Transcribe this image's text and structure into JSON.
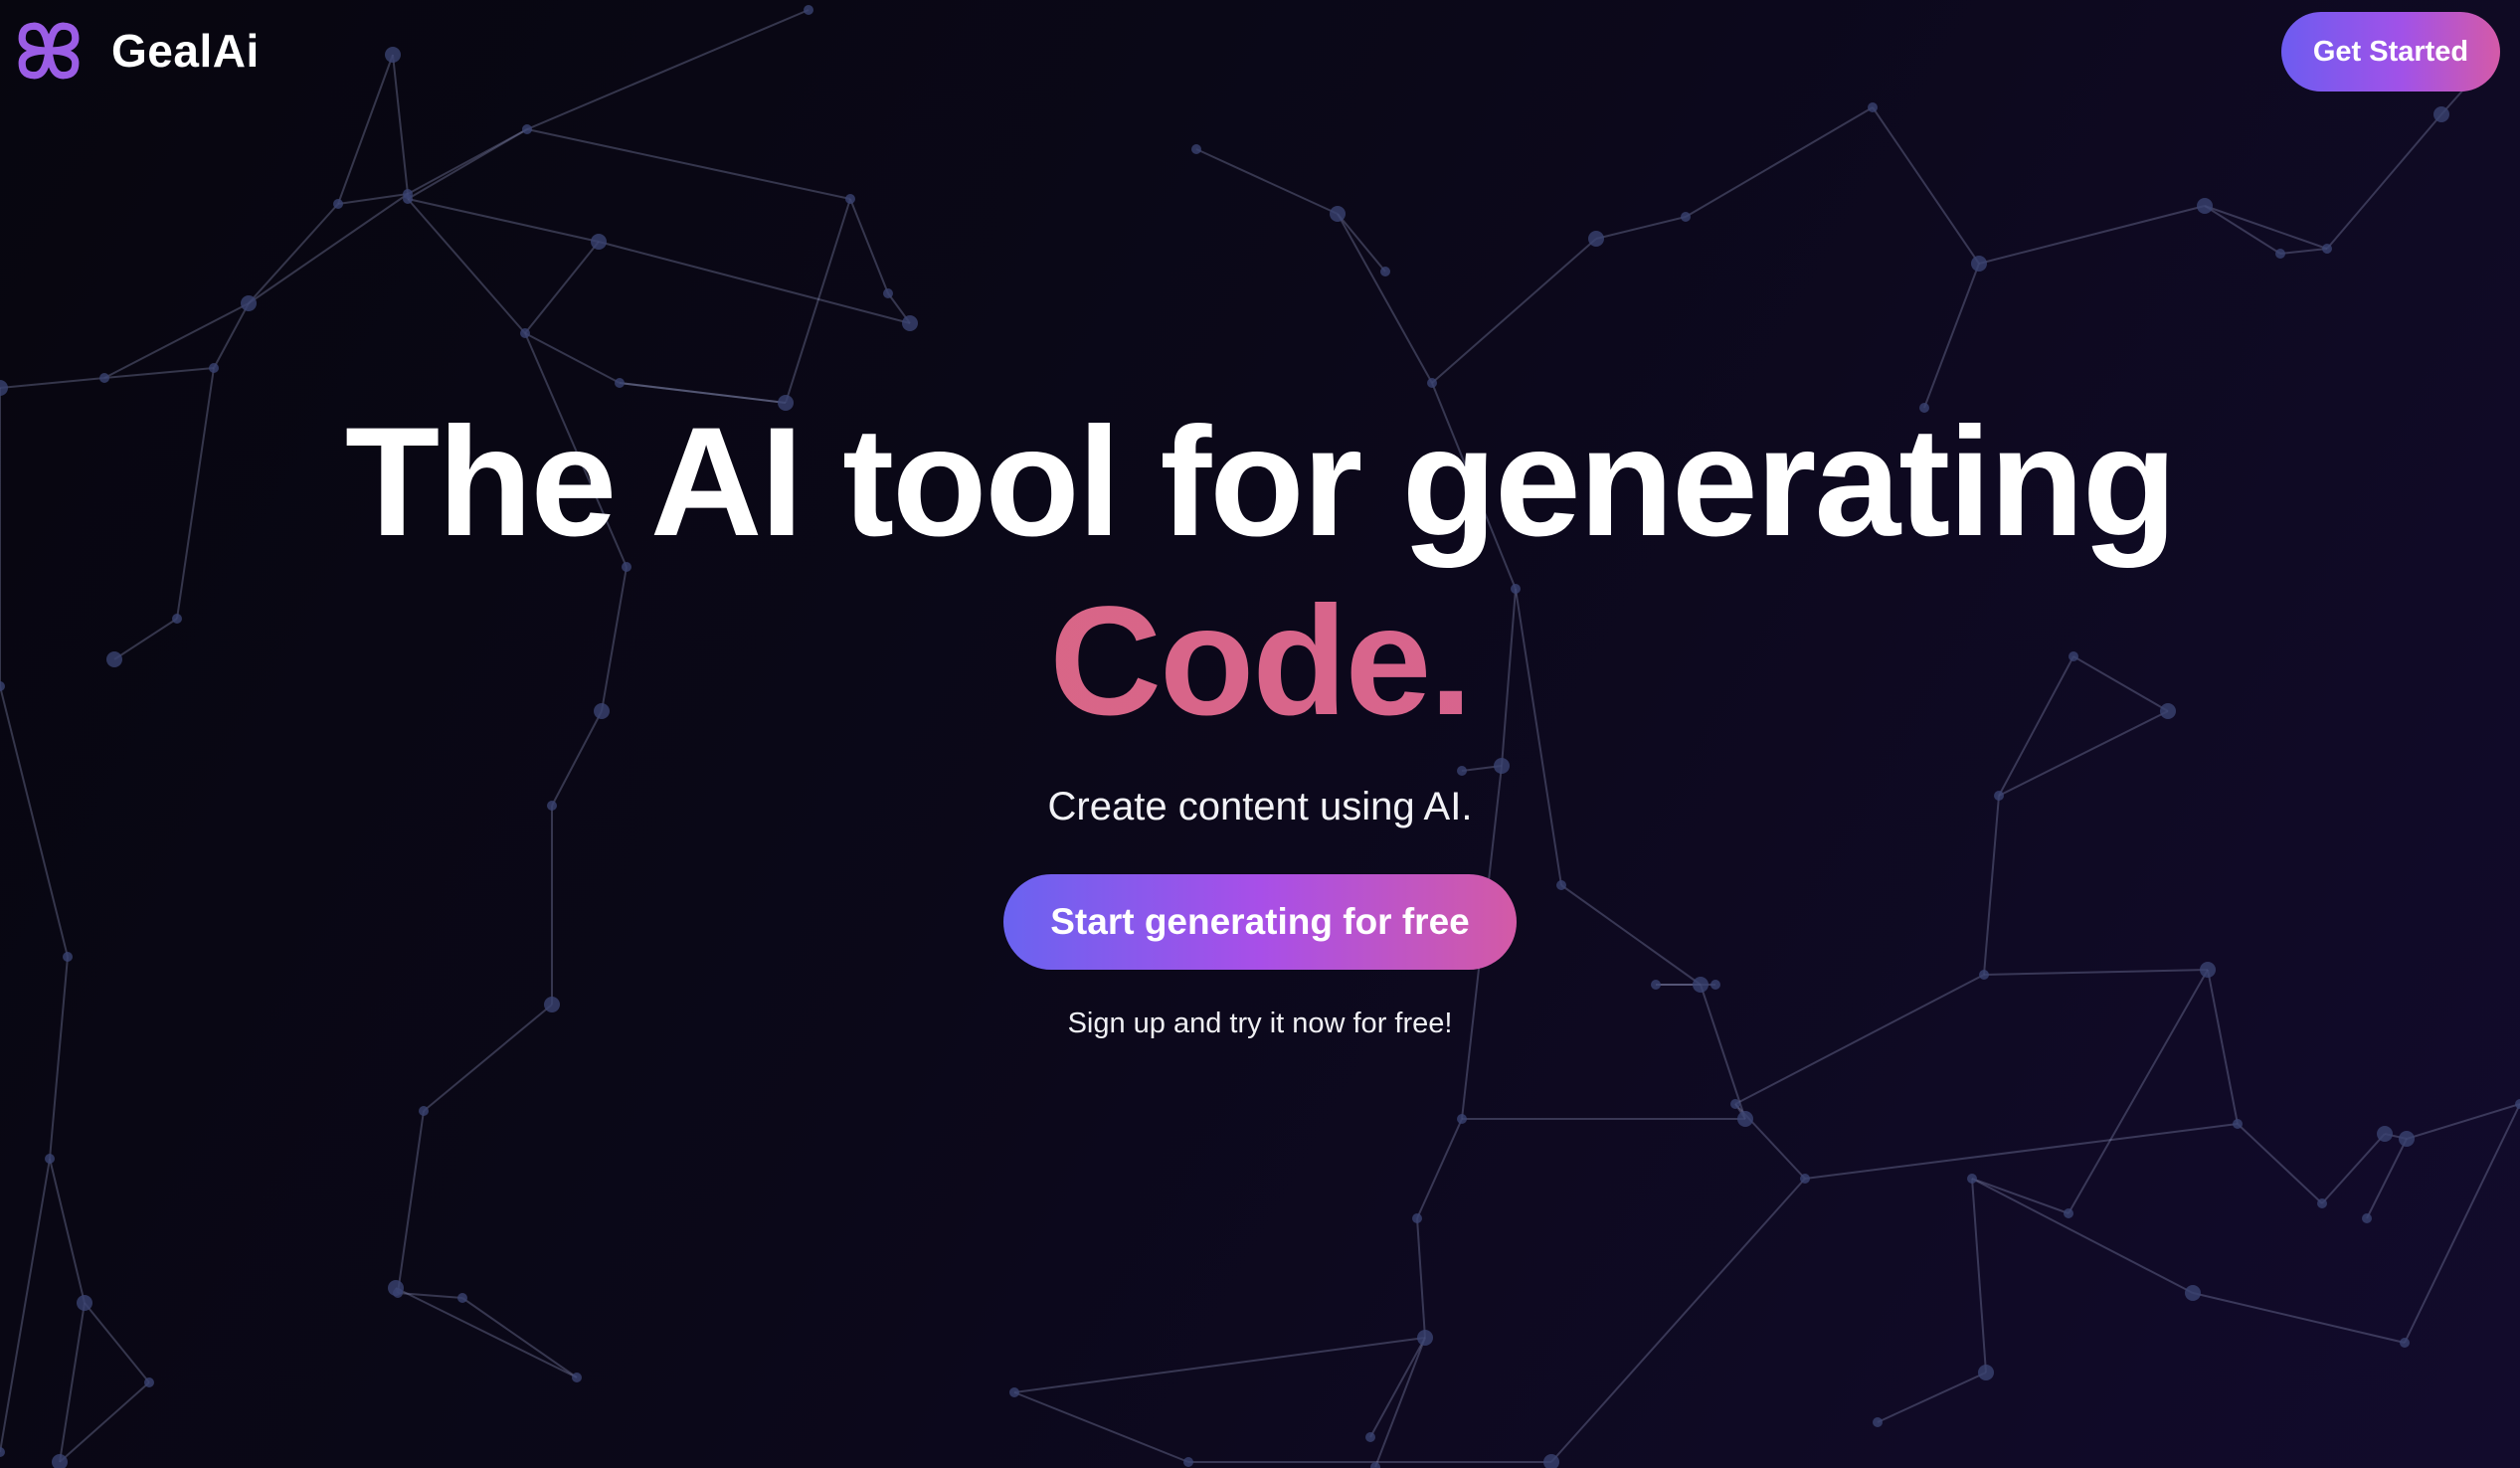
{
  "brand": {
    "name": "GealAi",
    "logo_icon": "link-cross-icon",
    "logo_color": "#9b5de5"
  },
  "header": {
    "cta_label": "Get Started"
  },
  "hero": {
    "headline": "The AI tool for generating",
    "headline_accent": "Code.",
    "subtitle": "Create content using AI.",
    "cta_label": "Start generating for free",
    "cta_note": "Sign up and try it now for free!"
  },
  "theme": {
    "background": "#0b0819",
    "accent_start": "#6a63f0",
    "accent_mid": "#a84fe8",
    "accent_end": "#d35aa6",
    "headline_accent_color": "#dc6878"
  }
}
